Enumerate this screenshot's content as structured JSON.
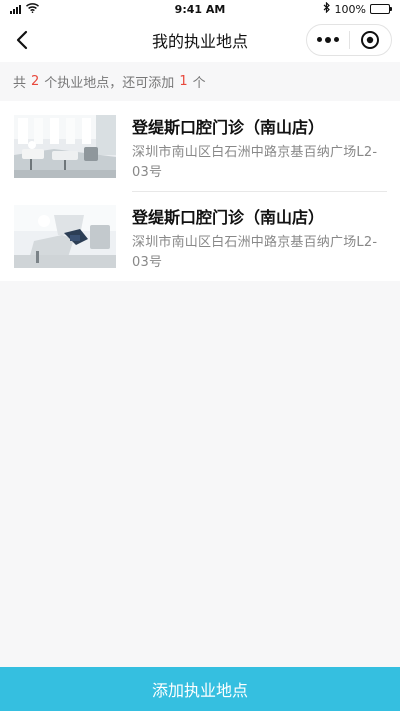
{
  "status_bar": {
    "time": "9:41 AM",
    "battery": "100%",
    "battery_level": 1.0
  },
  "nav": {
    "title": "我的执业地点"
  },
  "summary": {
    "prefix": "共",
    "total": "2",
    "middle": "个执业地点，还可添加",
    "remaining": "1",
    "suffix": "个"
  },
  "locations": [
    {
      "name": "登缇斯口腔门诊（南山店）",
      "address": "深圳市南山区白石洲中路京基百纳广场L2-03号"
    },
    {
      "name": "登缇斯口腔门诊（南山店）",
      "address": "深圳市南山区白石洲中路京基百纳广场L2-03号"
    }
  ],
  "footer": {
    "add_label": "添加执业地点"
  },
  "colors": {
    "accent": "#35bfe0",
    "highlight_number": "#e8483c"
  }
}
